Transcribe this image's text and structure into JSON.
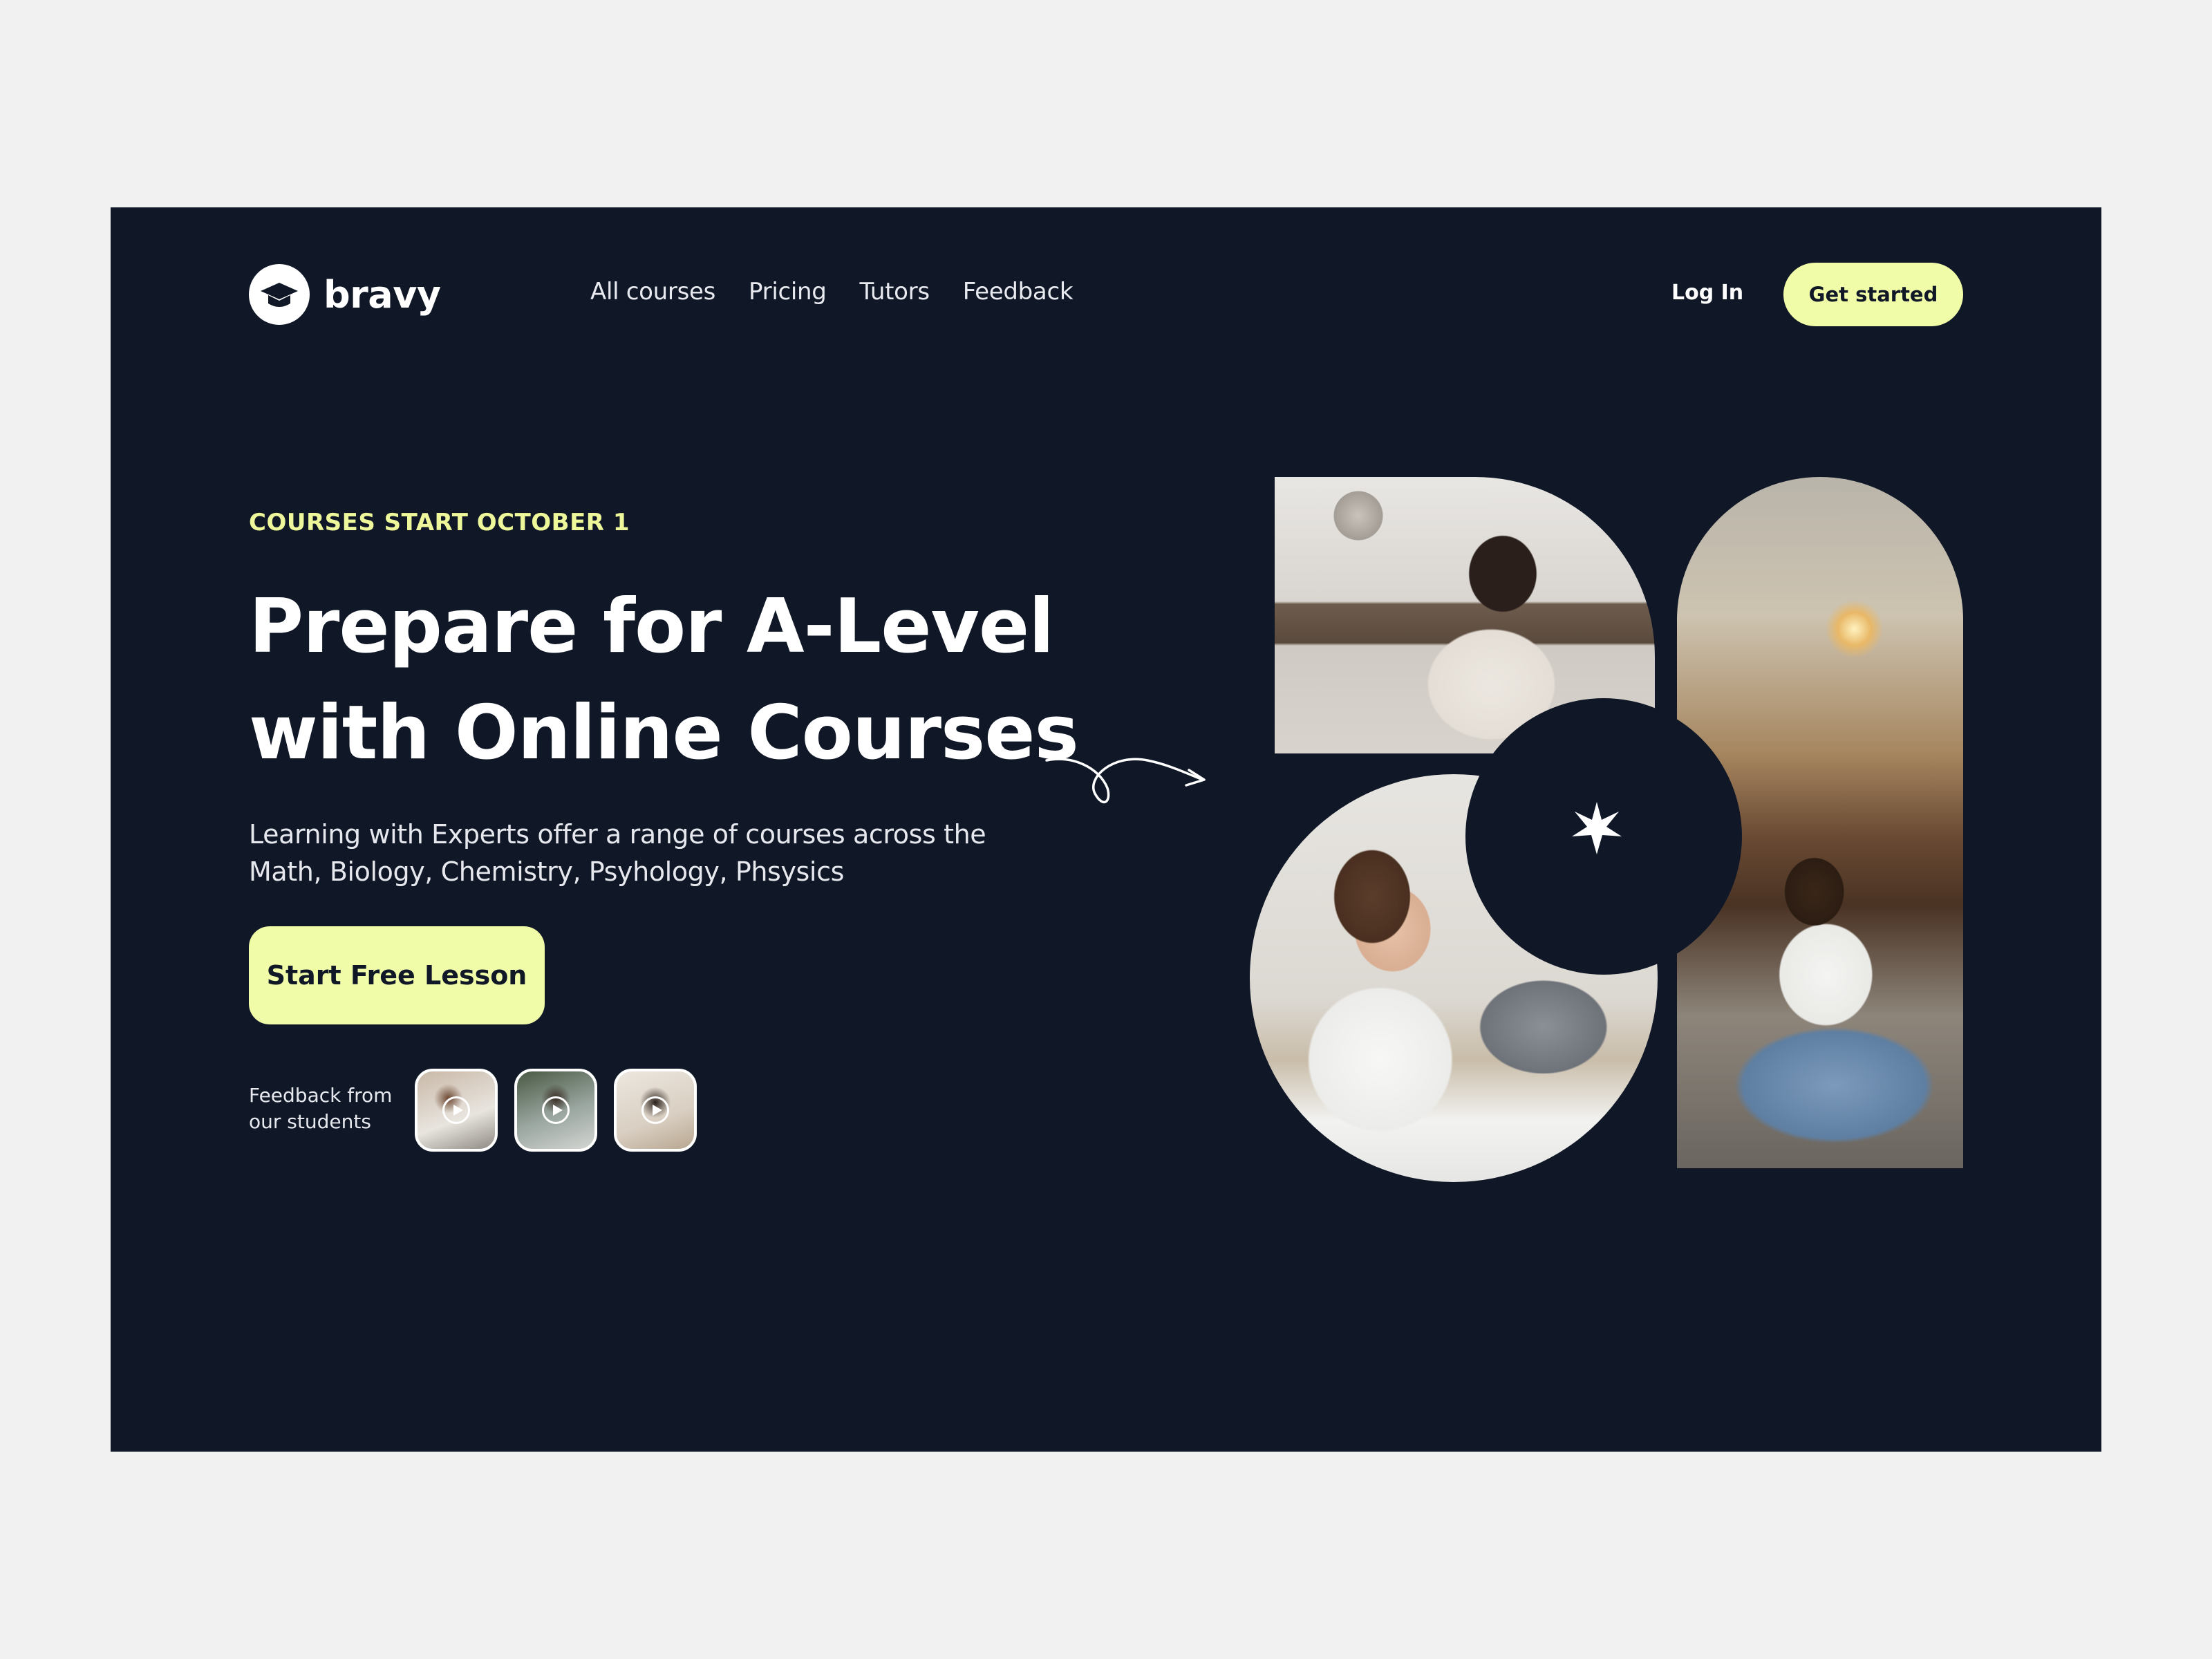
{
  "brand": {
    "name": "bravy"
  },
  "nav": {
    "items": [
      "All courses",
      "Pricing",
      "Tutors",
      "Feedback"
    ]
  },
  "auth": {
    "login": "Log In",
    "get_started": "Get started"
  },
  "hero": {
    "eyebrow": "COURSES START OCTOBER 1",
    "headline_line1": "Prepare for A-Level",
    "headline_line2": "with Online Courses",
    "sub_line1": "Learning with Experts offer a range of courses across the",
    "sub_line2": "Math, Biology, Chemistry, Psyhology, Phsysics",
    "cta": "Start Free Lesson"
  },
  "feedback": {
    "label_line1": "Feedback from",
    "label_line2": "our students"
  },
  "colors": {
    "background": "#101828",
    "accent": "#f1fca8",
    "page": "#f1f1f1"
  }
}
